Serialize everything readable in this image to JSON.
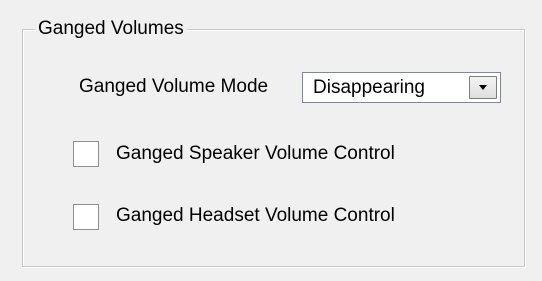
{
  "group": {
    "title": "Ganged Volumes"
  },
  "mode": {
    "label": "Ganged Volume Mode",
    "selected": "Disappearing"
  },
  "options": [
    {
      "label": "Ganged Speaker Volume Control",
      "checked": false
    },
    {
      "label": "Ganged Headset Volume Control",
      "checked": false
    }
  ],
  "icons": {
    "dropdown": "chevron-down-icon"
  }
}
